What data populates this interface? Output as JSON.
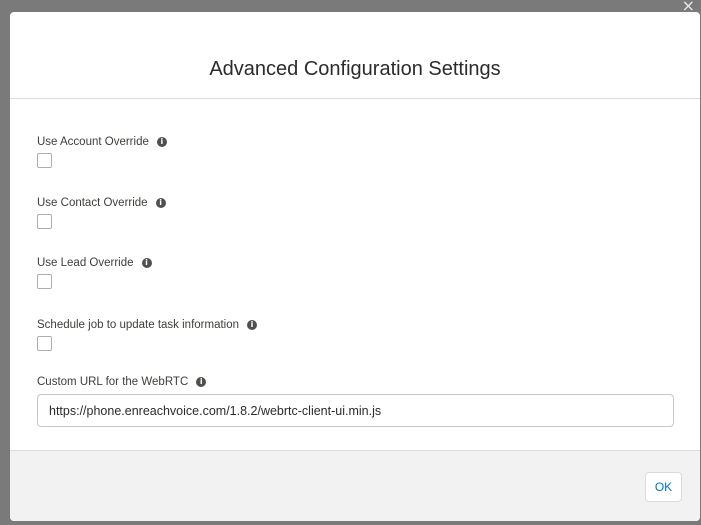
{
  "window": {
    "close_glyph": "×"
  },
  "modal": {
    "title": "Advanced Configuration Settings"
  },
  "fields": {
    "account_override": {
      "label": "Use Account Override",
      "checked": false
    },
    "contact_override": {
      "label": "Use Contact Override",
      "checked": false
    },
    "lead_override": {
      "label": "Use Lead Override",
      "checked": false
    },
    "schedule_job": {
      "label": "Schedule job to update task information",
      "checked": false
    },
    "custom_url": {
      "label": "Custom URL for the WebRTC",
      "value": "https://phone.enreachvoice.com/1.8.2/webrtc-client-ui.min.js"
    }
  },
  "footer": {
    "ok_label": "OK"
  },
  "icons": {
    "info": "info-icon",
    "close": "close-icon"
  },
  "colors": {
    "accent": "#0070d2",
    "backdrop": "#7a7a7a",
    "footer_bg": "#f3f2f2"
  }
}
